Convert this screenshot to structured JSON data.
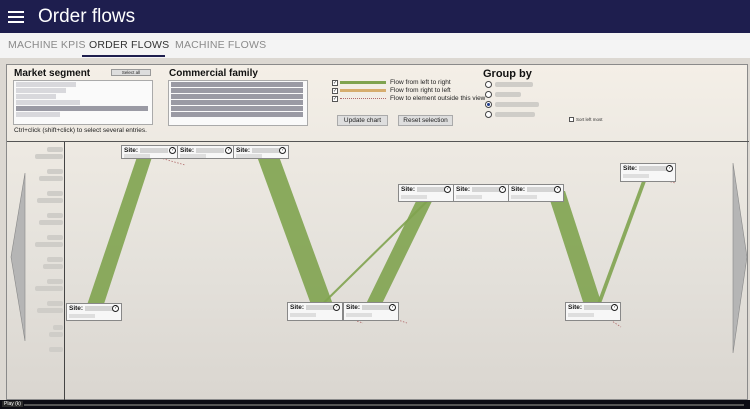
{
  "header": {
    "title": "Order flows"
  },
  "tabs": [
    {
      "label": "MACHINE KPIS"
    },
    {
      "label": "ORDER FLOWS"
    },
    {
      "label": "MACHINE FLOWS"
    }
  ],
  "filters": {
    "market_segment": {
      "label": "Market segment",
      "select_all": "Select all",
      "hint": "Ctrl+click (shift+click) to select several entries."
    },
    "commercial_family": {
      "label": "Commercial family"
    },
    "legend": [
      {
        "label": "Flow from left to right",
        "color": "#7fa34f"
      },
      {
        "label": "Flow from right to left",
        "color": "#d6ad6e"
      },
      {
        "label": "Flow to element outside this view",
        "color": "#b06a6a"
      }
    ],
    "buttons": {
      "update": "Update chart",
      "reset": "Reset selection"
    },
    "group_by": {
      "label": "Group by",
      "sort_left": "Sort left most"
    }
  },
  "chart": {
    "site_label": "Site:",
    "help_glyph": "?",
    "flow_color": "#7fa34f"
  },
  "footer": {
    "play": "Play (k)"
  }
}
